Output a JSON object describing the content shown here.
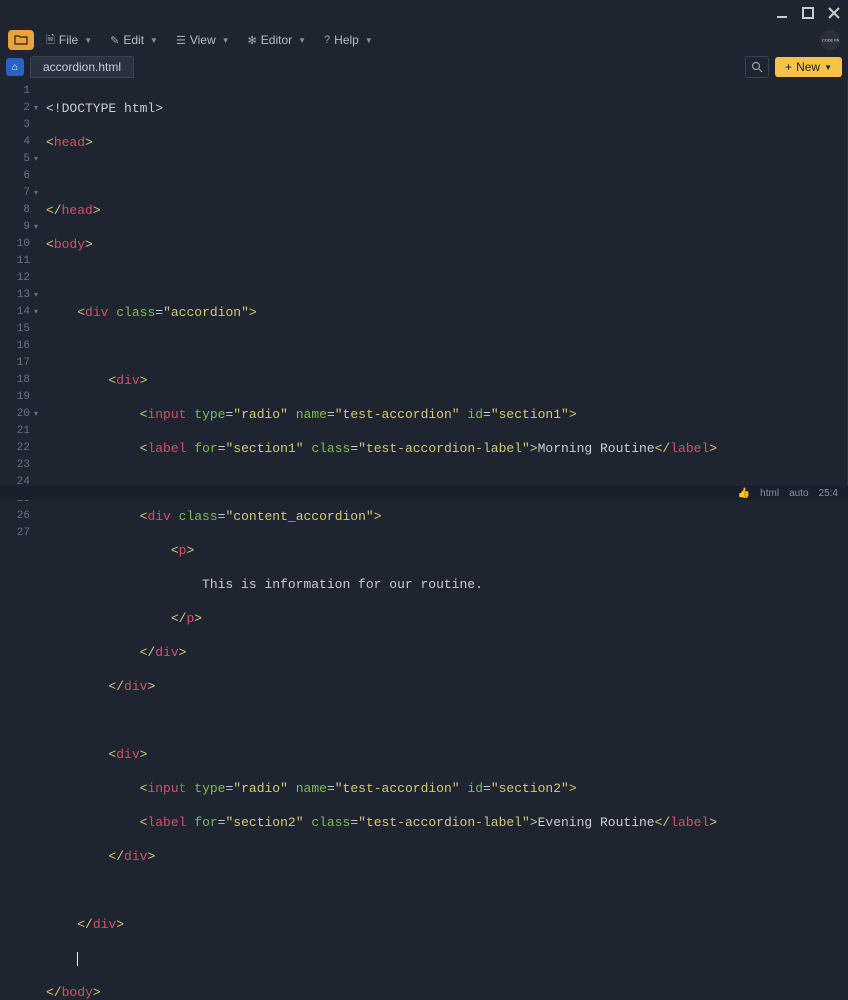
{
  "menu": {
    "file": "File",
    "edit": "Edit",
    "view": "View",
    "editor": "Editor",
    "help": "Help"
  },
  "badge": "CODE PA",
  "tab": {
    "filename": "accordion.html"
  },
  "new_button": "New",
  "code": {
    "l1": "<!DOCTYPE html>",
    "head_open": "head",
    "head_close": "head",
    "body_open": "body",
    "body_close": "body",
    "div": "div",
    "input": "input",
    "label": "label",
    "p": "p",
    "attr_class": "class",
    "attr_type": "type",
    "attr_name": "name",
    "attr_id": "id",
    "attr_for": "for",
    "val_accordion": "\"accordion\"",
    "val_radio": "\"radio\"",
    "val_testacc": "\"test-accordion\"",
    "val_section1": "\"section1\"",
    "val_section2": "\"section2\"",
    "val_label": "\"test-accordion-label\"",
    "val_content": "\"content_accordion\"",
    "text_morning": "Morning Routine",
    "text_evening": "Evening Routine",
    "text_info": "This is information for our routine."
  },
  "status": {
    "lang": "html",
    "mode": "auto",
    "pos": "25:4"
  }
}
